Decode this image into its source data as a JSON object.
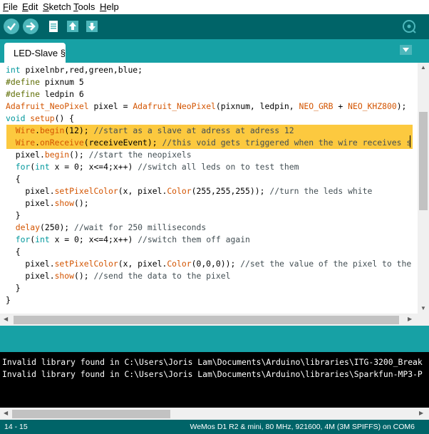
{
  "menu": [
    "File",
    "Edit",
    "Sketch",
    "Tools",
    "Help"
  ],
  "menu_underline": [
    "F",
    "E",
    "S",
    "T",
    "H"
  ],
  "menu_rest": [
    "ile",
    "dit",
    "ketch",
    "ools",
    "elp"
  ],
  "toolbar": {
    "buttons": [
      "verify-icon",
      "upload-icon",
      "new-icon",
      "open-icon",
      "save-icon",
      "serial-monitor-icon"
    ]
  },
  "tab": {
    "label": "LED-Slave §"
  },
  "code_lines": [
    [
      {
        "t": "int ",
        "c": "kw"
      },
      {
        "t": "pixelnbr,red,green,blue;",
        "c": "pl"
      }
    ],
    [
      {
        "t": "#define ",
        "c": "pp"
      },
      {
        "t": "pixnum 5",
        "c": "pl"
      }
    ],
    [
      {
        "t": "#define ",
        "c": "pp"
      },
      {
        "t": "ledpin 6",
        "c": "pl"
      }
    ],
    [
      {
        "t": "Adafruit_NeoPixel",
        "c": "fn"
      },
      {
        "t": " pixel = ",
        "c": "pl"
      },
      {
        "t": "Adafruit_NeoPixel",
        "c": "fn"
      },
      {
        "t": "(pixnum, ledpin, ",
        "c": "pl"
      },
      {
        "t": "NEO_GRB",
        "c": "fn"
      },
      {
        "t": " + ",
        "c": "pl"
      },
      {
        "t": "NEO_KHZ800",
        "c": "fn"
      },
      {
        "t": ");",
        "c": "pl"
      }
    ],
    [
      {
        "t": "void ",
        "c": "kw"
      },
      {
        "t": "setup",
        "c": "fn"
      },
      {
        "t": "() {",
        "c": "pl"
      }
    ],
    [
      {
        "t": "  Wire",
        "c": "fn"
      },
      {
        "t": ".",
        "c": "pl"
      },
      {
        "t": "begin",
        "c": "fn"
      },
      {
        "t": "(12); ",
        "c": "pl"
      },
      {
        "t": "//start as a slave at adress at adress 12",
        "c": "cm"
      }
    ],
    [
      {
        "t": "  Wire",
        "c": "fn"
      },
      {
        "t": ".",
        "c": "pl"
      },
      {
        "t": "onReceive",
        "c": "fn"
      },
      {
        "t": "(receiveEvent); ",
        "c": "pl"
      },
      {
        "t": "//this void gets triggered when the wire receives s",
        "c": "cm"
      }
    ],
    [
      {
        "t": "  pixel",
        "c": "pl"
      },
      {
        "t": ".",
        "c": "pl"
      },
      {
        "t": "begin",
        "c": "fn"
      },
      {
        "t": "(); ",
        "c": "pl"
      },
      {
        "t": "//start the neopixels",
        "c": "cm"
      }
    ],
    [
      {
        "t": "  for",
        "c": "kw"
      },
      {
        "t": "(",
        "c": "pl"
      },
      {
        "t": "int",
        "c": "kw"
      },
      {
        "t": " x = 0; x<=4;x++) ",
        "c": "pl"
      },
      {
        "t": "//switch all leds on to test them",
        "c": "cm"
      }
    ],
    [
      {
        "t": "  {",
        "c": "pl"
      }
    ],
    [
      {
        "t": "    pixel.",
        "c": "pl"
      },
      {
        "t": "setPixelColor",
        "c": "fn"
      },
      {
        "t": "(x, pixel.",
        "c": "pl"
      },
      {
        "t": "Color",
        "c": "fn"
      },
      {
        "t": "(255,255,255)); ",
        "c": "pl"
      },
      {
        "t": "//turn the leds white",
        "c": "cm"
      }
    ],
    [
      {
        "t": "    pixel.",
        "c": "pl"
      },
      {
        "t": "show",
        "c": "fn"
      },
      {
        "t": "();",
        "c": "pl"
      }
    ],
    [
      {
        "t": "  }",
        "c": "pl"
      }
    ],
    [
      {
        "t": "  delay",
        "c": "fn"
      },
      {
        "t": "(250); ",
        "c": "pl"
      },
      {
        "t": "//wait for 250 milliseconds",
        "c": "cm"
      }
    ],
    [
      {
        "t": "  for",
        "c": "kw"
      },
      {
        "t": "(",
        "c": "pl"
      },
      {
        "t": "int",
        "c": "kw"
      },
      {
        "t": " x = 0; x<=4;x++) ",
        "c": "pl"
      },
      {
        "t": "//switch them off again",
        "c": "cm"
      }
    ],
    [
      {
        "t": "  {",
        "c": "pl"
      }
    ],
    [
      {
        "t": "    pixel.",
        "c": "pl"
      },
      {
        "t": "setPixelColor",
        "c": "fn"
      },
      {
        "t": "(x, pixel.",
        "c": "pl"
      },
      {
        "t": "Color",
        "c": "fn"
      },
      {
        "t": "(0,0,0)); ",
        "c": "pl"
      },
      {
        "t": "//set the value of the pixel to the",
        "c": "cm"
      }
    ],
    [
      {
        "t": "    pixel.",
        "c": "pl"
      },
      {
        "t": "show",
        "c": "fn"
      },
      {
        "t": "(); ",
        "c": "pl"
      },
      {
        "t": "//send the data to the pixel",
        "c": "cm"
      }
    ],
    [
      {
        "t": "  }",
        "c": "pl"
      }
    ],
    [
      {
        "t": "}",
        "c": "pl"
      }
    ]
  ],
  "highlighted_lines": [
    5,
    6
  ],
  "console_lines": [
    "Invalid library found in C:\\Users\\Joris Lam\\Documents\\Arduino\\libraries\\ITG-3200_Break",
    "Invalid library found in C:\\Users\\Joris Lam\\Documents\\Arduino\\libraries\\Sparkfun-MP3-P"
  ],
  "status": {
    "position": "14 - 15",
    "board": "WeMos D1 R2 & mini, 80 MHz, 921600, 4M (3M SPIFFS) on COM6"
  },
  "colors": {
    "toolbar": "#006468",
    "tabbar": "#17a1a5",
    "highlight": "#fcc93f",
    "keyword": "#00979c",
    "function": "#d35400",
    "comment": "#434f54",
    "preprocessor": "#5e6d03"
  }
}
